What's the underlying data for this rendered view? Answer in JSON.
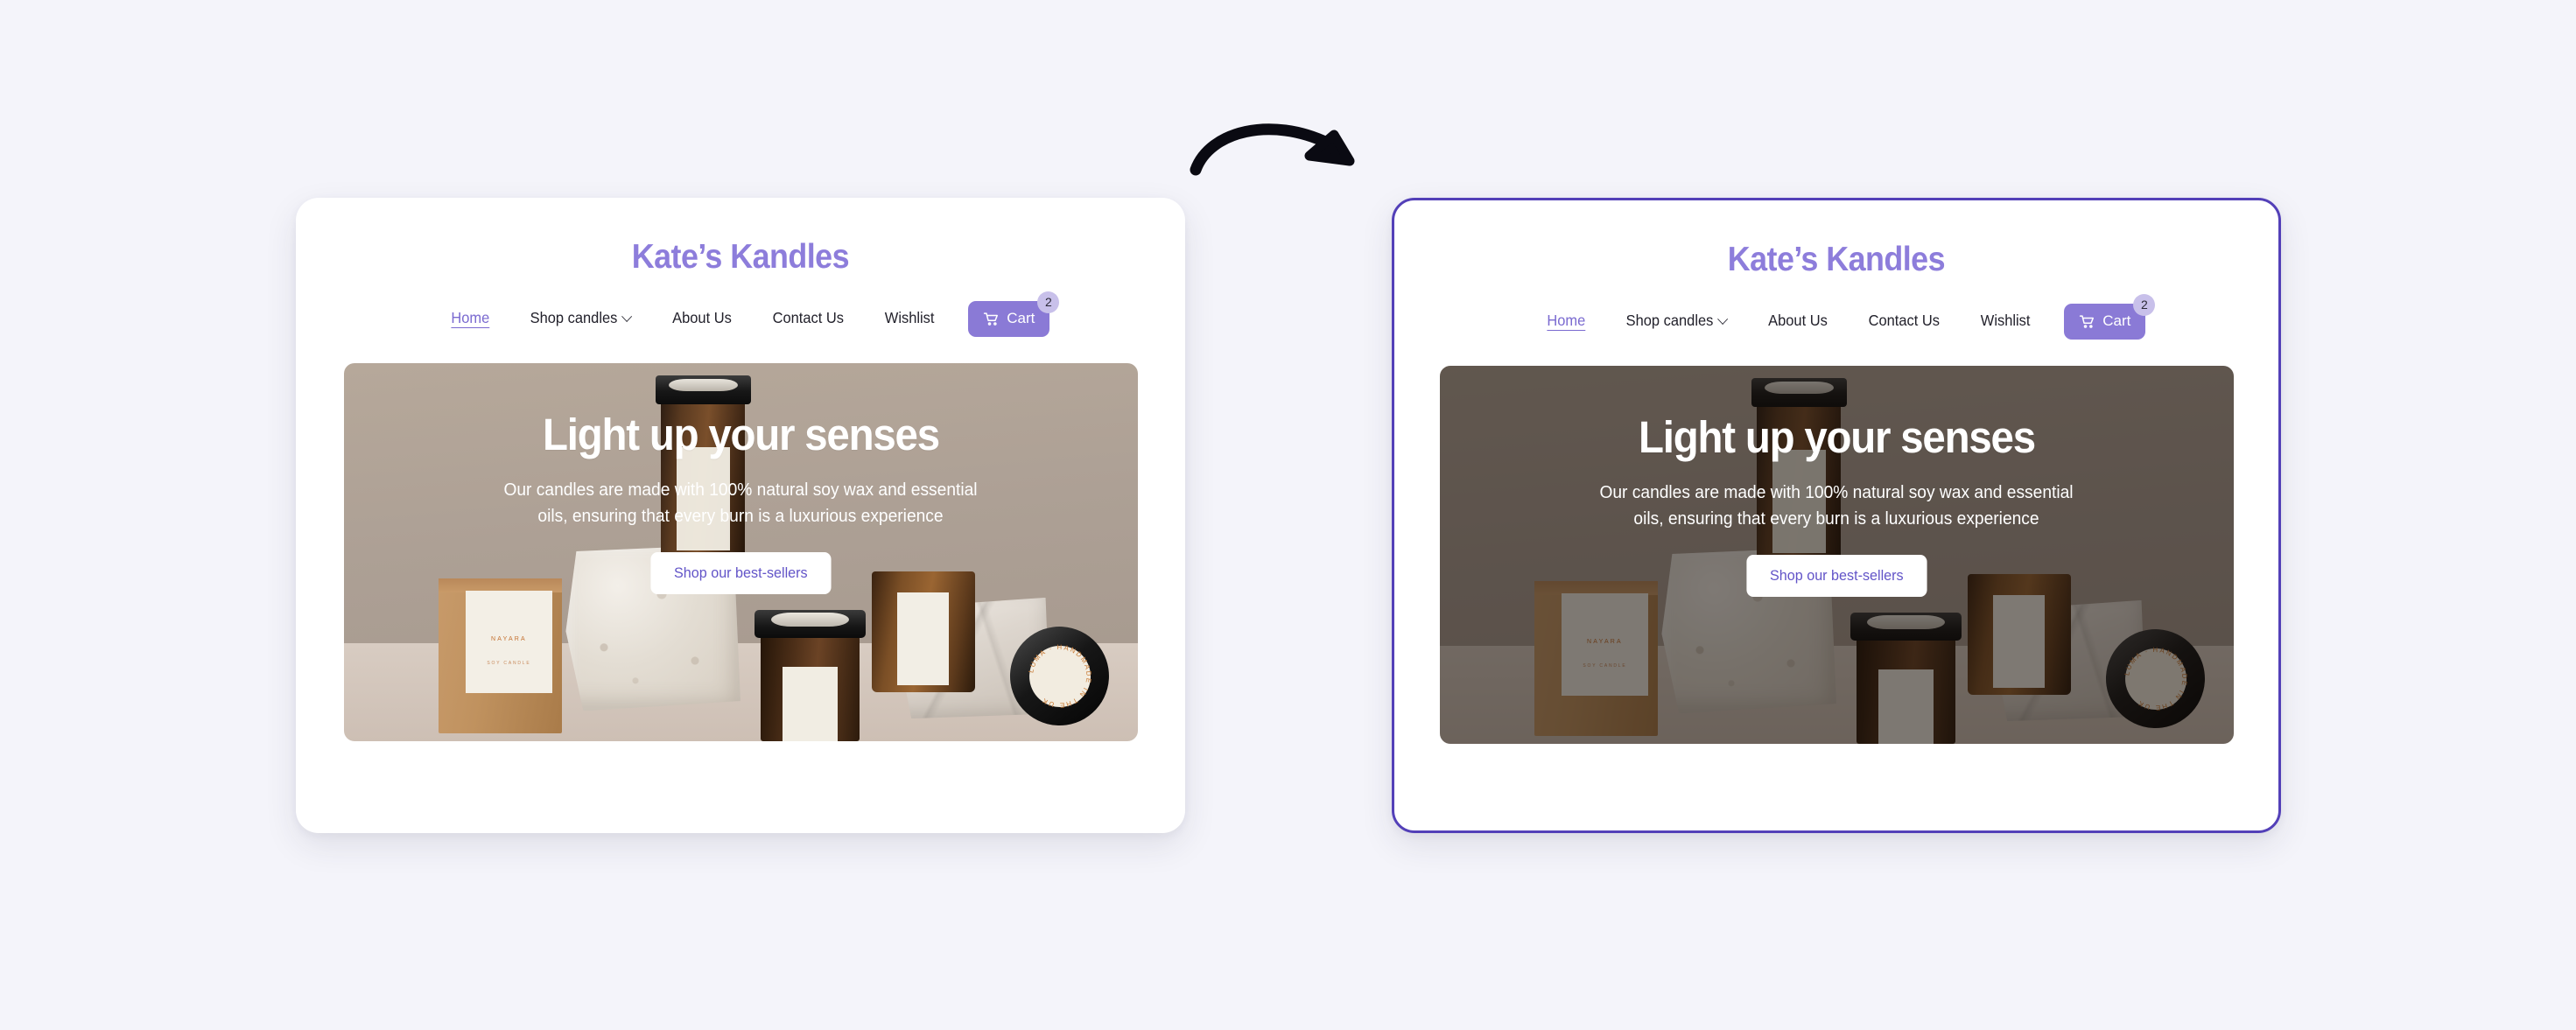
{
  "page": {
    "background_color": "#f4f4fa",
    "accent_purple": "#8a7ad6",
    "highlight_border_color": "#5340b8"
  },
  "annotation": {
    "arrow_icon": "curved-arrow-right",
    "arrow_color": "#0a0a12"
  },
  "site": {
    "title": "Kate’s Kandles",
    "title_color": "#8d7ddb",
    "nav": [
      {
        "label": "Home",
        "active": true,
        "has_chevron": false
      },
      {
        "label": "Shop candles",
        "active": false,
        "has_chevron": true
      },
      {
        "label": "About Us",
        "active": false,
        "has_chevron": false
      },
      {
        "label": "Contact Us",
        "active": false,
        "has_chevron": false
      },
      {
        "label": "Wishlist",
        "active": false,
        "has_chevron": false
      }
    ],
    "cart": {
      "label": "Cart",
      "icon": "shopping-cart-icon",
      "badge_count": "2",
      "button_color": "#8a7ad6",
      "badge_color": "#c8c0ea"
    },
    "hero": {
      "title": "Light up your senses",
      "subtitle": "Our candles are made with 100% natural soy wax and essential oils, ensuring that every burn is a luxurious experience",
      "cta_label": "Shop our best-sellers",
      "cta_text_color": "#6254c8",
      "photo_alt": "candle-product-photo",
      "photo_labels": {
        "kraft_box_brand": "NAYARA",
        "kraft_box_sub": "SOY CANDLE",
        "lid_ring_text": "LUMA · HANDMADE IN THE UK"
      }
    }
  },
  "panels": {
    "before": {
      "name": "before-variant",
      "hero_overlay": "none",
      "has_highlight_border": false
    },
    "after": {
      "name": "after-variant",
      "hero_overlay": "dark-scrim",
      "has_highlight_border": true
    }
  }
}
